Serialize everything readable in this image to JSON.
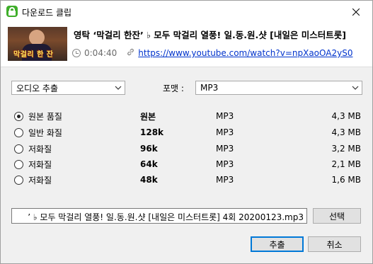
{
  "window": {
    "title": "다운로드 클립"
  },
  "video": {
    "title": "영탁 ‘막걸리 한잔’ ♭ 모두 막걸리 열풍! 일.동.원.샷 [내일은 미스터트롯]",
    "thumbnail_caption": "막걸리 한 잔",
    "duration": "0:04:40",
    "url": "https://www.youtube.com/watch?v=npXaoOA2yS0"
  },
  "mode_select": {
    "value": "오디오 추출"
  },
  "format": {
    "label": "포맷 :",
    "value": "MP3"
  },
  "qualities": [
    {
      "label": "원본 품질",
      "bitrate": "원본",
      "format": "MP3",
      "size": "4,3 MB",
      "selected": true
    },
    {
      "label": "일반 화질",
      "bitrate": "128k",
      "format": "MP3",
      "size": "4,3 MB",
      "selected": false
    },
    {
      "label": "저화질",
      "bitrate": "96k",
      "format": "MP3",
      "size": "3,2 MB",
      "selected": false
    },
    {
      "label": "저화질",
      "bitrate": "64k",
      "format": "MP3",
      "size": "2,1 MB",
      "selected": false
    },
    {
      "label": "저화질",
      "bitrate": "48k",
      "format": "MP3",
      "size": "1,6 MB",
      "selected": false
    }
  ],
  "filename": {
    "value": "’ ♭ 모두 막걸리 열풍! 일.동.원.샷 [내일은 미스터트롯] 4회 20200123.mp3"
  },
  "buttons": {
    "browse": "선택",
    "extract": "추출",
    "cancel": "취소"
  },
  "colors": {
    "app_icon": "#3fae2a",
    "link": "#0033cc",
    "primary_border": "#0078d7"
  },
  "icons": {
    "app": "lock-icon",
    "close": "close-icon",
    "duration": "clock-icon",
    "url": "link-icon",
    "dropdown": "chevron-down-icon"
  }
}
